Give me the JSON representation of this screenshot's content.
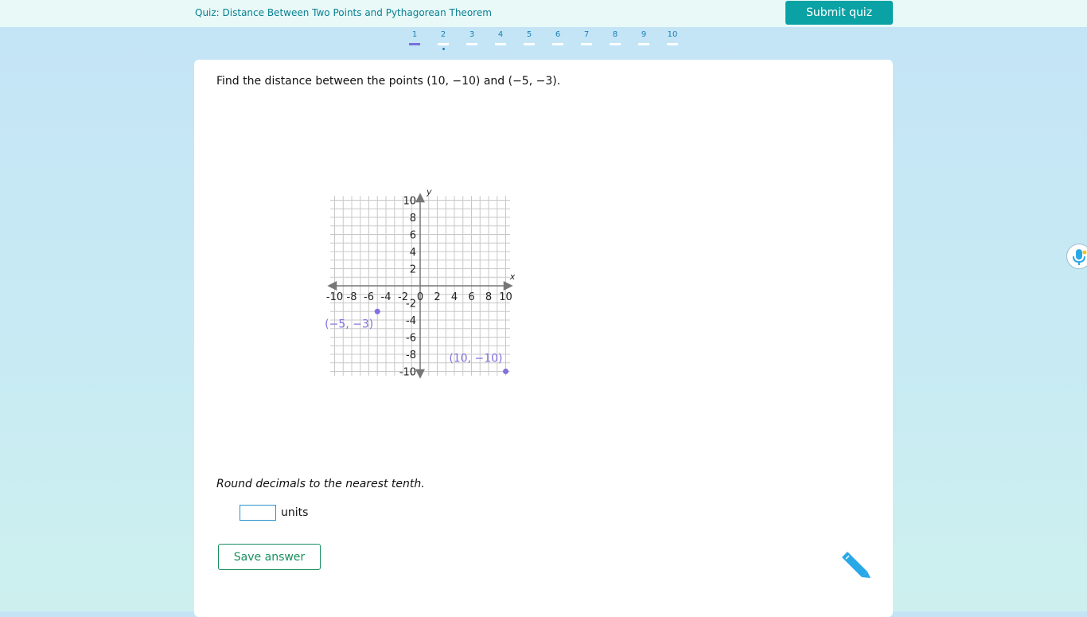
{
  "header": {
    "quiz_title": "Quiz: Distance Between Two Points and Pythagorean Theorem",
    "submit_label": "Submit quiz"
  },
  "question_nav": {
    "items": [
      "1",
      "2",
      "3",
      "4",
      "5",
      "6",
      "7",
      "8",
      "9",
      "10"
    ],
    "active": "1",
    "marked": "2"
  },
  "question": {
    "prompt": "Find the distance between the points (10, −10) and (−5, −3).",
    "round_note": "Round decimals to the nearest tenth.",
    "answer_value": "",
    "units_label": "units",
    "save_label": "Save answer"
  },
  "chart_data": {
    "type": "scatter",
    "xlabel": "x",
    "ylabel": "y",
    "xlim": [
      -10,
      10
    ],
    "ylim": [
      -10,
      10
    ],
    "x_ticks": [
      "-10",
      "-8",
      "-6",
      "-4",
      "-2",
      "0",
      "2",
      "4",
      "6",
      "8",
      "10"
    ],
    "y_ticks": [
      "10",
      "8",
      "6",
      "4",
      "2",
      "-2",
      "-4",
      "-6",
      "-8",
      "-10"
    ],
    "grid": true,
    "points": [
      {
        "x": -5,
        "y": -3,
        "label": "(−5, −3)"
      },
      {
        "x": 10,
        "y": -10,
        "label": "(10, −10)"
      }
    ],
    "point_color": "#8070e0"
  },
  "colors": {
    "accent": "#0aa2a4",
    "save_border": "#178f5f",
    "pencil": "#29a8e8"
  },
  "icons": {
    "pencil": "pencil-icon",
    "mic": "microphone-icon"
  }
}
